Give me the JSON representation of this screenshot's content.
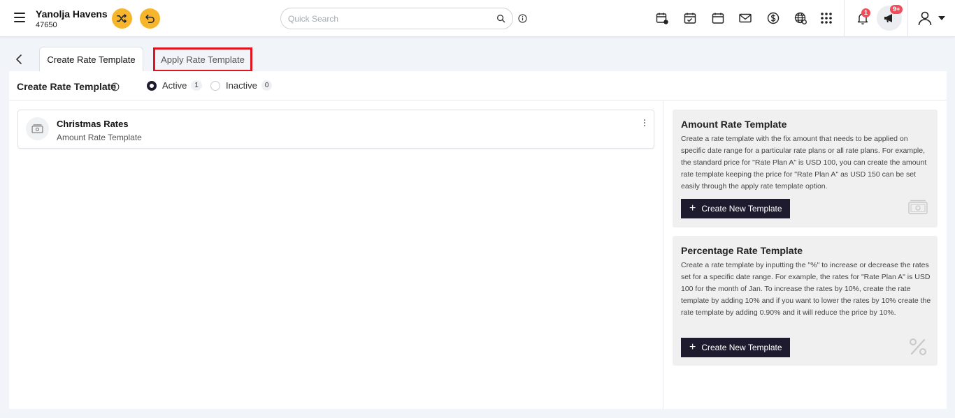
{
  "header": {
    "hotel_name": "Yanolja Havens",
    "hotel_id": "47650",
    "search_placeholder": "Quick Search",
    "notification_count": "1",
    "announcement_count": "9+",
    "accent_color": "#f7b52c"
  },
  "tabs": {
    "create": "Create Rate Template",
    "apply": "Apply Rate Template"
  },
  "subheader": {
    "title": "Create Rate Template",
    "active_label": "Active",
    "active_count": "1",
    "inactive_label": "Inactive",
    "inactive_count": "0"
  },
  "templates": [
    {
      "name": "Christmas Rates",
      "type": "Amount Rate Template"
    }
  ],
  "info_cards": {
    "amount": {
      "title": "Amount Rate Template",
      "description": "Create a rate template with the fix amount that needs to be applied on specific date range for a particular rate plans or all rate plans. For example, the standard price for \"Rate Plan A\" is USD 100, you can create the amount rate template keeping the price for \"Rate Plan A\" as USD 150 can be set easily through the apply rate template option.",
      "button": "Create New Template"
    },
    "percentage": {
      "title": "Percentage Rate Template",
      "description": "Create a rate template by inputting the \"%\" to increase or decrease the rates set for a specific date range. For example, the rates for \"Rate Plan A\" is USD 100 for the month of Jan. To increase the rates by 10%, create the rate template by adding 10% and if you want to lower the rates by 10% create the rate template by adding 0.90% and it will reduce the price by 10%.",
      "button": "Create New Template"
    }
  }
}
